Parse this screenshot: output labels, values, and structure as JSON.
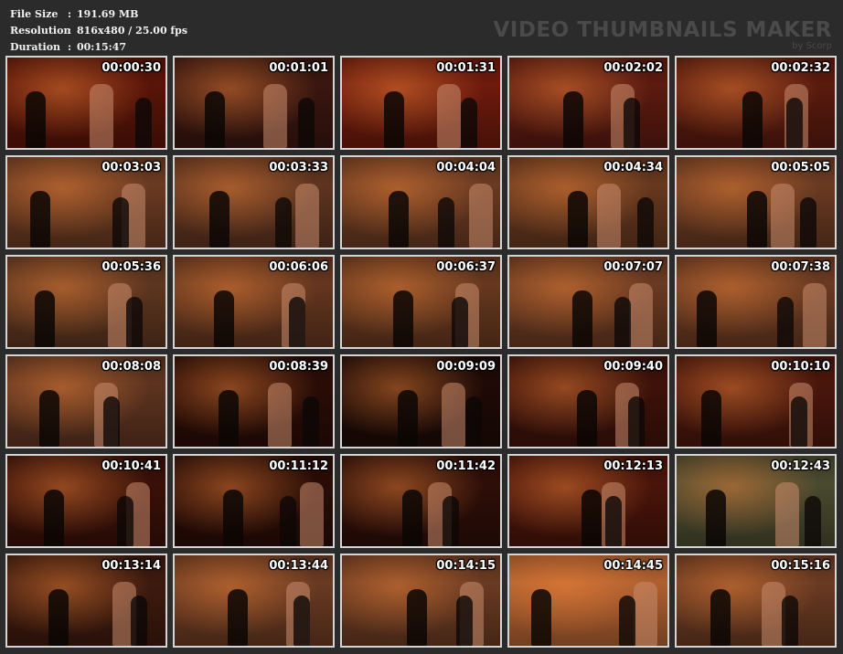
{
  "info": {
    "file_size_label": "File Size",
    "file_size_value": "191.69 MB",
    "resolution_label": "Resolution",
    "resolution_value": "816x480 / 25.00 fps",
    "duration_label": "Duration",
    "duration_value": "00:15:47",
    "separator": ":"
  },
  "watermark": {
    "title": "VIDEO THUMBNAILS MAKER",
    "subtitle": "by Scorp"
  },
  "thumbnails": [
    {
      "time": "00:00:30",
      "bg": "#5a1408"
    },
    {
      "time": "00:01:01",
      "bg": "#3a1610"
    },
    {
      "time": "00:01:31",
      "bg": "#6e1a0c"
    },
    {
      "time": "00:02:02",
      "bg": "#5c1a10"
    },
    {
      "time": "00:02:32",
      "bg": "#5a1a0e"
    },
    {
      "time": "00:03:03",
      "bg": "#6a3a22"
    },
    {
      "time": "00:03:33",
      "bg": "#5e3420"
    },
    {
      "time": "00:04:04",
      "bg": "#6a3a22"
    },
    {
      "time": "00:04:34",
      "bg": "#66381f"
    },
    {
      "time": "00:05:05",
      "bg": "#6a3a22"
    },
    {
      "time": "00:05:36",
      "bg": "#5e3620"
    },
    {
      "time": "00:06:06",
      "bg": "#64361f"
    },
    {
      "time": "00:06:37",
      "bg": "#66381f"
    },
    {
      "time": "00:07:07",
      "bg": "#6a3a22"
    },
    {
      "time": "00:07:38",
      "bg": "#6a3a22"
    },
    {
      "time": "00:08:08",
      "bg": "#5e3420"
    },
    {
      "time": "00:08:39",
      "bg": "#2a0c06"
    },
    {
      "time": "00:09:09",
      "bg": "#1e0a06"
    },
    {
      "time": "00:09:40",
      "bg": "#3e120a"
    },
    {
      "time": "00:10:10",
      "bg": "#4a160c"
    },
    {
      "time": "00:10:41",
      "bg": "#3a1008"
    },
    {
      "time": "00:11:12",
      "bg": "#2a0c06"
    },
    {
      "time": "00:11:42",
      "bg": "#2e0e08"
    },
    {
      "time": "00:12:13",
      "bg": "#4a140a"
    },
    {
      "time": "00:12:43",
      "bg": "#4a4a30"
    },
    {
      "time": "00:13:14",
      "bg": "#3e1a0e"
    },
    {
      "time": "00:13:44",
      "bg": "#6a3a22"
    },
    {
      "time": "00:14:15",
      "bg": "#6a3a22"
    },
    {
      "time": "00:14:45",
      "bg": "#b06030"
    },
    {
      "time": "00:15:16",
      "bg": "#6a3a22"
    }
  ]
}
